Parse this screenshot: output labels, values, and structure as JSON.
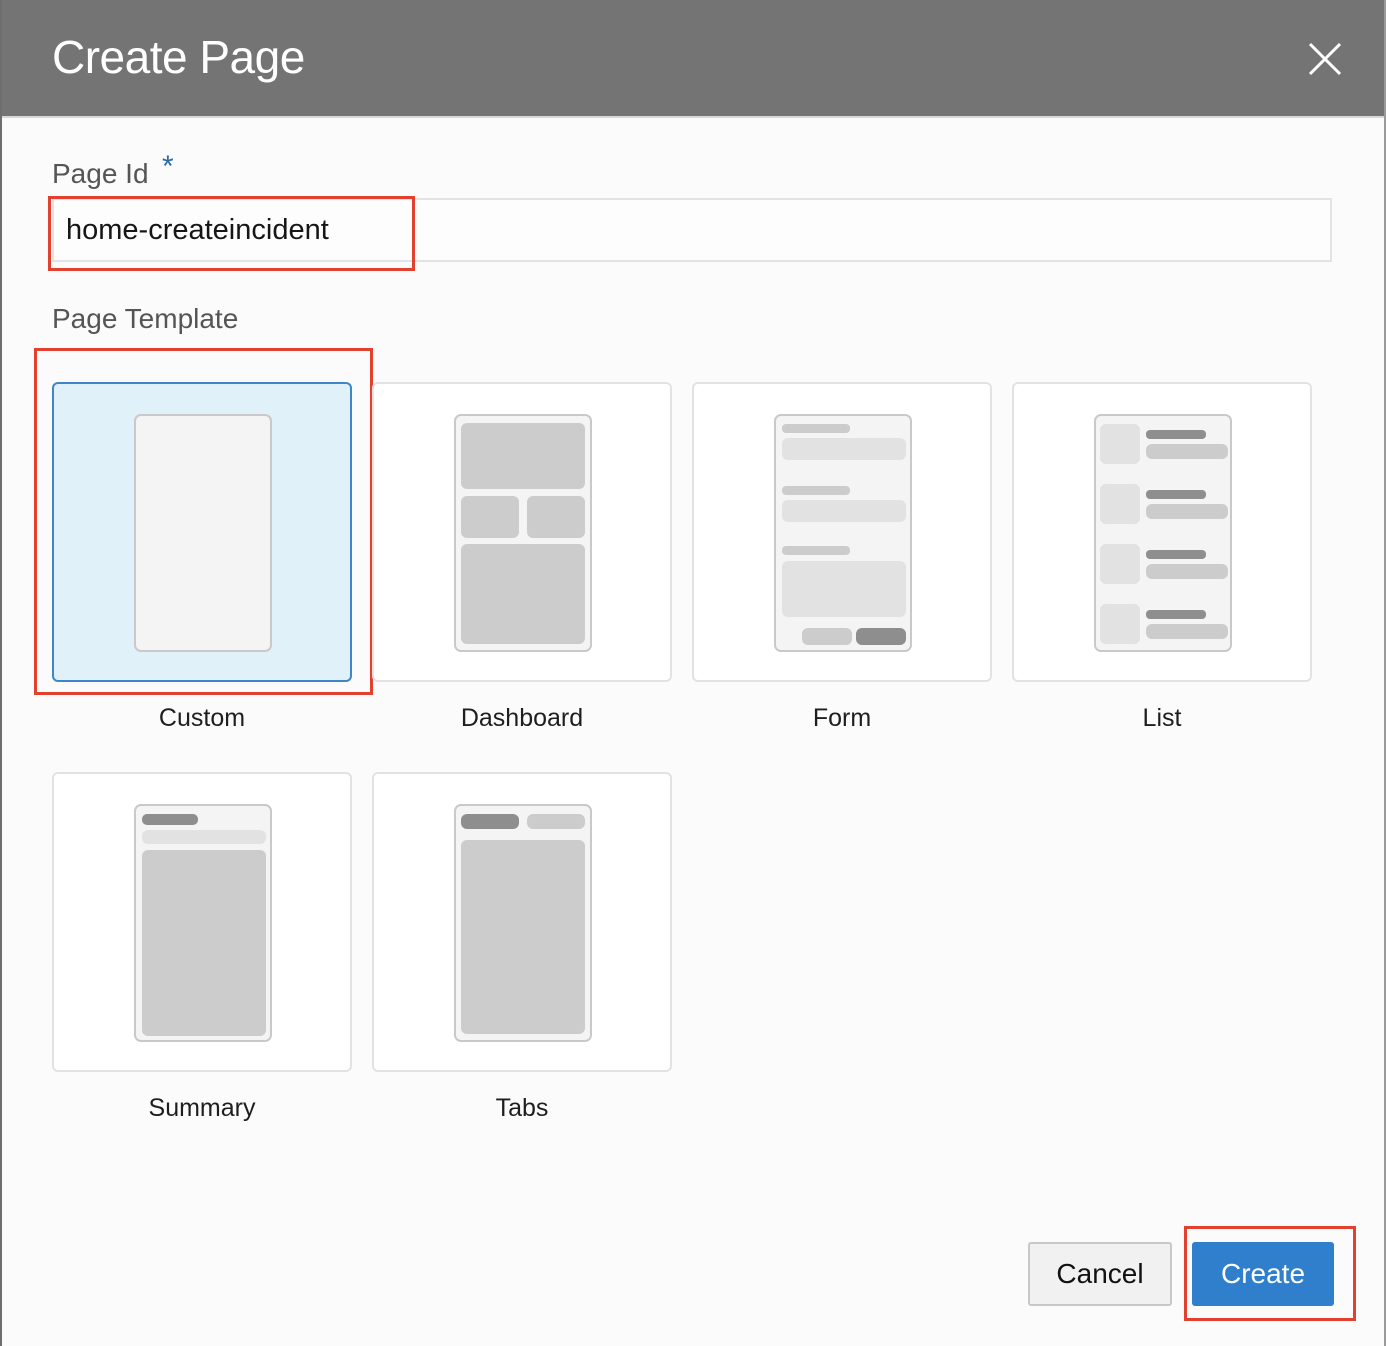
{
  "dialog": {
    "title": "Create Page",
    "close_icon": "close-icon"
  },
  "page_id": {
    "label": "Page Id",
    "required_mark": "*",
    "value": "home-createincident"
  },
  "page_template": {
    "label": "Page Template",
    "selected": "Custom",
    "options": [
      "Custom",
      "Dashboard",
      "Form",
      "List",
      "Summary",
      "Tabs"
    ]
  },
  "footer": {
    "cancel_label": "Cancel",
    "create_label": "Create"
  },
  "colors": {
    "header_bg": "#747474",
    "accent_blue": "#2f7fcd",
    "selected_card_bg": "#e0f1f9",
    "highlight_red": "#e2412f"
  }
}
